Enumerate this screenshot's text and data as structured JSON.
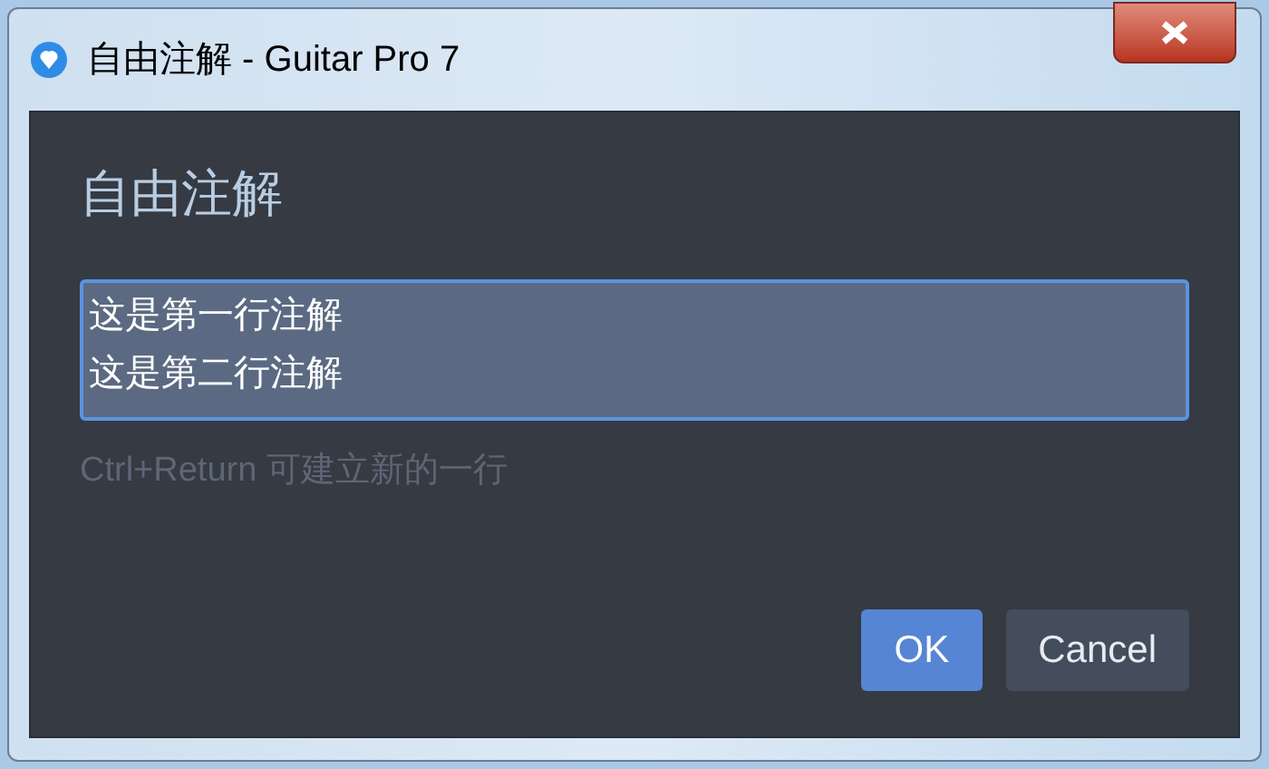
{
  "window": {
    "title": "自由注解 - Guitar Pro 7"
  },
  "dialog": {
    "heading": "自由注解",
    "text_lines": [
      "这是第一行注解",
      "这是第二行注解"
    ],
    "hint": "Ctrl+Return 可建立新的一行",
    "buttons": [
      {
        "label": "OK",
        "kind": "primary"
      },
      {
        "label": "Cancel",
        "kind": "secondary"
      }
    ]
  }
}
